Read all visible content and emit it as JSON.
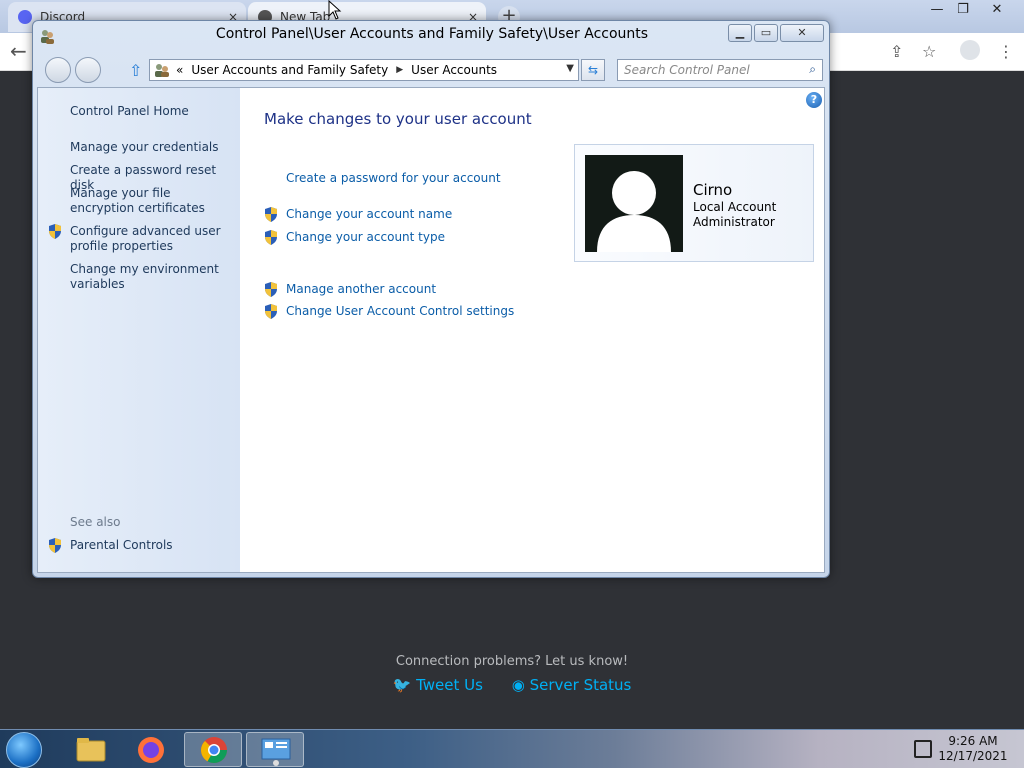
{
  "browser": {
    "tabs": [
      {
        "label": "Discord"
      },
      {
        "label": "New Tab"
      }
    ],
    "new_tab_glyph": "+",
    "close_glyph": "×"
  },
  "discord": {
    "connection_text": "Connection problems? Let us know!",
    "tweet_label": "Tweet Us",
    "status_label": "Server Status",
    "link_color": "#00b0f4"
  },
  "window": {
    "title": "Control Panel\\User Accounts and Family Safety\\User Accounts",
    "breadcrumb": [
      "User Accounts and Family Safety",
      "User Accounts"
    ],
    "breadcrumb_prefix": "«",
    "search_placeholder": "Search Control Panel"
  },
  "sidebar": {
    "home": "Control Panel Home",
    "items": [
      {
        "label": "Manage your credentials",
        "shield": false
      },
      {
        "label": "Create a password reset disk",
        "shield": false
      },
      {
        "label": "Manage your file encryption certificates",
        "shield": false
      },
      {
        "label": "Configure advanced user profile properties",
        "shield": true
      },
      {
        "label": "Change my environment variables",
        "shield": false
      }
    ],
    "see_also": "See also",
    "parental": "Parental Controls"
  },
  "main": {
    "title": "Make changes to your user account",
    "tasks": [
      {
        "label": "Create a password for your account",
        "shield": false
      },
      {
        "label": "Change your account name",
        "shield": true
      },
      {
        "label": "Change your account type",
        "shield": true
      },
      {
        "label": "Manage another account",
        "shield": true
      },
      {
        "label": "Change User Account Control settings",
        "shield": true
      }
    ],
    "title_color": "#1e3287",
    "link_color": "#0b5da8"
  },
  "user": {
    "name": "Cirno",
    "account_type": "Local Account",
    "role": "Administrator"
  },
  "taskbar": {
    "time": "9:26 AM",
    "date": "12/17/2021"
  },
  "icons": {
    "shield": "uac-shield-icon",
    "help": "?"
  }
}
